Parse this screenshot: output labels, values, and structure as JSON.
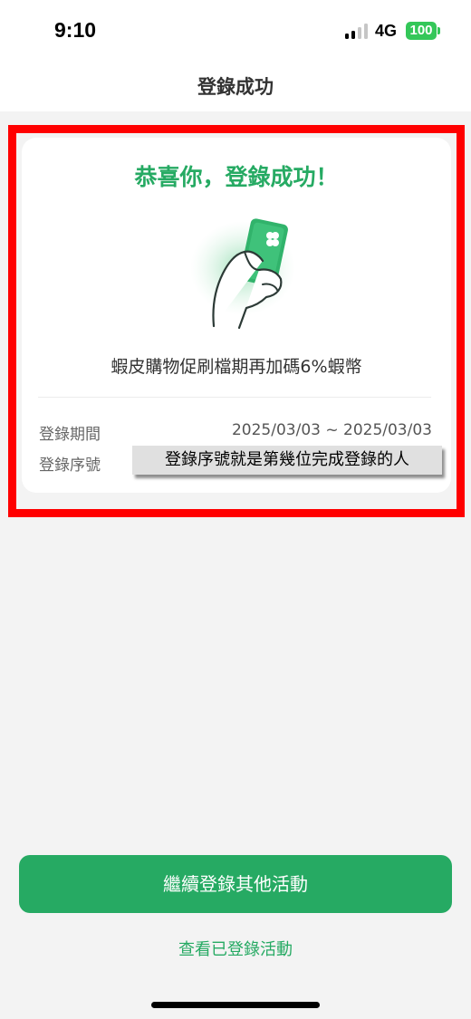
{
  "status_bar": {
    "time": "9:10",
    "network": "4G",
    "battery": "100",
    "signal_bars_active": 2,
    "signal_bars_total": 4
  },
  "nav": {
    "title": "登錄成功"
  },
  "card": {
    "title": "恭喜你，登錄成功！",
    "illustration_icon": "hand-holding-card-icon",
    "campaign": "蝦皮購物促刷檔期再加碼6%蝦幣",
    "rows": [
      {
        "label": "登錄期間",
        "value": "2025/03/03 ~ 2025/03/03"
      },
      {
        "label": "登錄序號",
        "value": ""
      }
    ]
  },
  "annotation": {
    "text": "登錄序號就是第幾位完成登錄的人"
  },
  "actions": {
    "primary_label": "繼續登錄其他活動",
    "secondary_label": "查看已登錄活動"
  },
  "colors": {
    "accent": "#26aa63",
    "highlight": "#ff0000",
    "battery": "#34c759",
    "background": "#f3f3f3"
  }
}
